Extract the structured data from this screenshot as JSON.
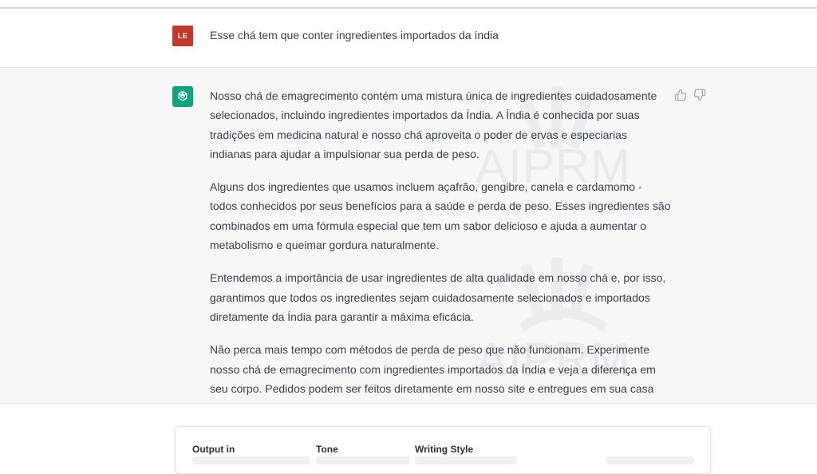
{
  "user_message": {
    "avatar_initials": "LE",
    "avatar_color": "#c0392b",
    "text": "Esse chá tem que conter ingredientes importados da índia"
  },
  "assistant_message": {
    "avatar_icon": "openai-logo-icon",
    "avatar_color": "#10a37f",
    "paragraphs": [
      "Nosso chá de emagrecimento contém uma mistura única de ingredientes cuidadosamente selecionados, incluindo ingredientes importados da Índia. A Índia é conhecida por suas tradições em medicina natural e nosso chá aproveita o poder de ervas e especiarias indianas para ajudar a impulsionar sua perda de peso.",
      "Alguns dos ingredientes que usamos incluem açafrão, gengibre, canela e cardamomo - todos conhecidos por seus benefícios para a saúde e perda de peso. Esses ingredientes são combinados em uma fórmula especial que tem um sabor delicioso e ajuda a aumentar o metabolismo e queimar gordura naturalmente.",
      "Entendemos a importância de usar ingredientes de alta qualidade em nosso chá e, por isso, garantimos que todos os ingredientes sejam cuidadosamente selecionados e importados diretamente da Índia para garantir a máxima eficácia.",
      "Não perca mais tempo com métodos de perda de peso que não funcionam. Experimente nosso chá de emagrecimento com ingredientes importados da Índia e veja a diferença em seu corpo. Pedidos podem ser feitos diretamente em nosso site e entregues em sua casa em"
    ],
    "feedback_icons": [
      "thumbs-up-icon",
      "thumbs-down-icon"
    ]
  },
  "watermark": {
    "text_1": "AIPRM",
    "text_2": "AIPRM"
  },
  "prompt_panel": {
    "output_label": "Output in",
    "tone_label": "Tone",
    "writing_style_label": "Writing Style"
  }
}
